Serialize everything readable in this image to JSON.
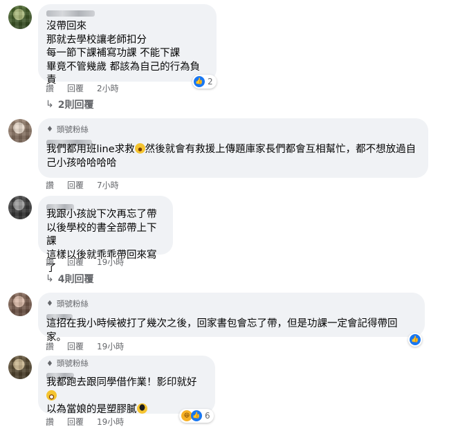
{
  "actions": {
    "like": "讚",
    "reply": "回覆"
  },
  "comments": [
    {
      "id": "c1",
      "badge": "",
      "lines": [
        "沒帶回來",
        "那就去學校讓老師扣分",
        "每一節下課補寫功課 不能下課",
        "畢竟不管幾歲 都該為自己的行為負責"
      ],
      "time": "2小時",
      "reactions": {
        "types": [
          "like"
        ],
        "count": "2"
      },
      "replies": "2則回覆",
      "avatar_colors": [
        "#4e6b2e",
        "#a8b87a",
        "#2f4420"
      ]
    },
    {
      "id": "c2",
      "badge": "頭號粉絲",
      "lines": [
        "我們都用班line求救{rofl}然後就會有救援上傳題庫家長們都會互相幫忙，都不想放過自",
        "己小孩哈哈哈哈"
      ],
      "time": "7小時",
      "reactions": null,
      "replies": "",
      "avatar_colors": [
        "#a08a78",
        "#e4d6c8",
        "#6e5a4c"
      ]
    },
    {
      "id": "c3",
      "badge": "",
      "lines": [
        "我跟小孩說下次再忘了帶",
        "以後學校的書全部帶上下課",
        "這樣以後就乖乖帶回來寫了"
      ],
      "time": "19小時",
      "reactions": null,
      "replies": "4則回覆",
      "avatar_colors": [
        "#4a4a4a",
        "#9a9a9a",
        "#2a2a2a"
      ]
    },
    {
      "id": "c4",
      "badge": "頭號粉絲",
      "lines": [
        "這招在我小時候被打了幾次之後，回家書包會忘了帶，但是功課一定會記得帶回家。"
      ],
      "time": "19小時",
      "reactions": {
        "types": [
          "like"
        ],
        "count": ""
      },
      "replies": "",
      "avatar_colors": [
        "#8c6e5e",
        "#d8b8a6",
        "#5c4438"
      ]
    },
    {
      "id": "c5",
      "badge": "頭號粉絲",
      "lines": [
        "我都跑去跟同學借作業！影印就好{grin}",
        "以為當娘的是塑膠膩{cool}"
      ],
      "time": "19小時",
      "reactions": {
        "types": [
          "haha",
          "like"
        ],
        "count": "6"
      },
      "replies": "",
      "avatar_colors": [
        "#6a5a3e",
        "#c8b48e",
        "#3e3422"
      ]
    }
  ]
}
